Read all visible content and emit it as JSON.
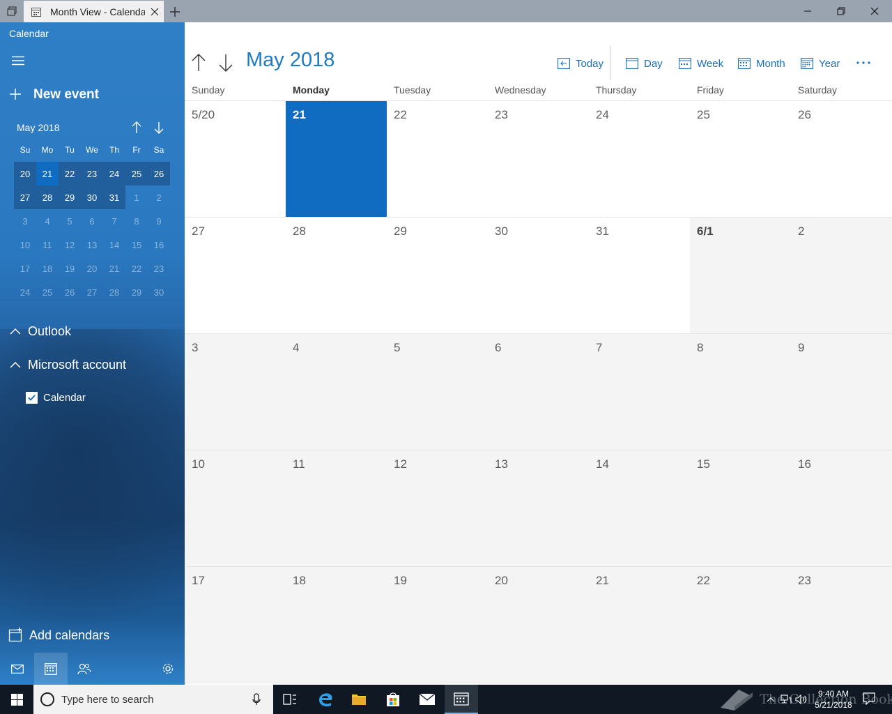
{
  "window": {
    "tab_title": "Month View - Calendar"
  },
  "sidebar": {
    "app_name": "Calendar",
    "new_event_label": "New event",
    "mini_calendar": {
      "title": "May 2018",
      "weekdays": [
        "Su",
        "Mo",
        "Tu",
        "We",
        "Th",
        "Fr",
        "Sa"
      ],
      "rows": [
        [
          "20",
          "21",
          "22",
          "23",
          "24",
          "25",
          "26"
        ],
        [
          "27",
          "28",
          "29",
          "30",
          "31",
          "1",
          "2"
        ],
        [
          "3",
          "4",
          "5",
          "6",
          "7",
          "8",
          "9"
        ],
        [
          "10",
          "11",
          "12",
          "13",
          "14",
          "15",
          "16"
        ],
        [
          "17",
          "18",
          "19",
          "20",
          "21",
          "22",
          "23"
        ],
        [
          "24",
          "25",
          "26",
          "27",
          "28",
          "29",
          "30"
        ]
      ],
      "today": "21"
    },
    "accounts": [
      {
        "label": "Outlook"
      },
      {
        "label": "Microsoft account"
      }
    ],
    "calendar_item": {
      "label": "Calendar",
      "checked": true
    },
    "add_calendars_label": "Add calendars"
  },
  "main": {
    "month_title": "May 2018",
    "views": {
      "today": "Today",
      "day": "Day",
      "week": "Week",
      "month": "Month",
      "year": "Year"
    },
    "weekdays": [
      "Sunday",
      "Monday",
      "Tuesday",
      "Wednesday",
      "Thursday",
      "Friday",
      "Saturday"
    ],
    "current_weekday": "Monday",
    "weeks": [
      [
        "5/20",
        "21",
        "22",
        "23",
        "24",
        "25",
        "26"
      ],
      [
        "27",
        "28",
        "29",
        "30",
        "31",
        "6/1",
        "2"
      ],
      [
        "3",
        "4",
        "5",
        "6",
        "7",
        "8",
        "9"
      ],
      [
        "10",
        "11",
        "12",
        "13",
        "14",
        "15",
        "16"
      ],
      [
        "17",
        "18",
        "19",
        "20",
        "21",
        "22",
        "23"
      ]
    ],
    "today_cell": "21"
  },
  "taskbar": {
    "search_placeholder": "Type here to search",
    "time": "9:40 AM",
    "date": "5/21/2018",
    "watermark": "The Collection Book"
  },
  "colors": {
    "accent": "#1f7ac6",
    "today_fill": "#0f6cc0",
    "sidebar": "#2a78c0",
    "taskbar": "#101923"
  }
}
